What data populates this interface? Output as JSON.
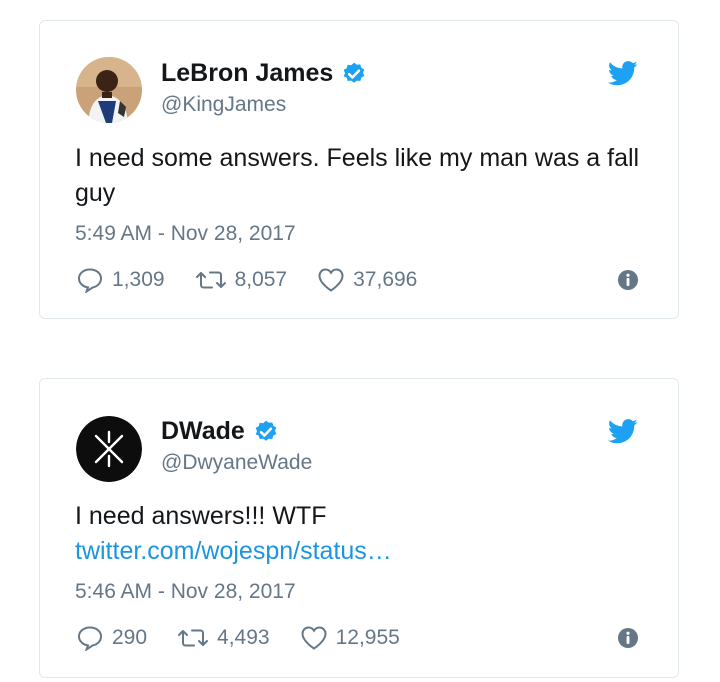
{
  "tweets": [
    {
      "name": "LeBron James",
      "handle": "@KingJames",
      "text": "I need some answers. Feels like my man was a fall guy",
      "link": "",
      "timestamp": "5:49 AM - Nov 28, 2017",
      "replies": "1,309",
      "retweets": "8,057",
      "likes": "37,696"
    },
    {
      "name": "DWade",
      "handle": "@DwyaneWade",
      "text": "I need answers!!! WTF",
      "link": "twitter.com/wojespn/status…",
      "timestamp": "5:46 AM - Nov 28, 2017",
      "replies": "290",
      "retweets": "4,493",
      "likes": "12,955"
    }
  ],
  "icons": {
    "verified": "verified-badge-icon",
    "bird": "twitter-bird-icon",
    "reply": "reply-icon",
    "retweet": "retweet-icon",
    "like": "heart-icon",
    "info": "info-icon"
  },
  "colors": {
    "twitter_blue": "#1da1f2",
    "link_blue": "#1b95e0",
    "muted_gray": "#657786",
    "text": "#14171a",
    "border": "#e1e8ed"
  }
}
